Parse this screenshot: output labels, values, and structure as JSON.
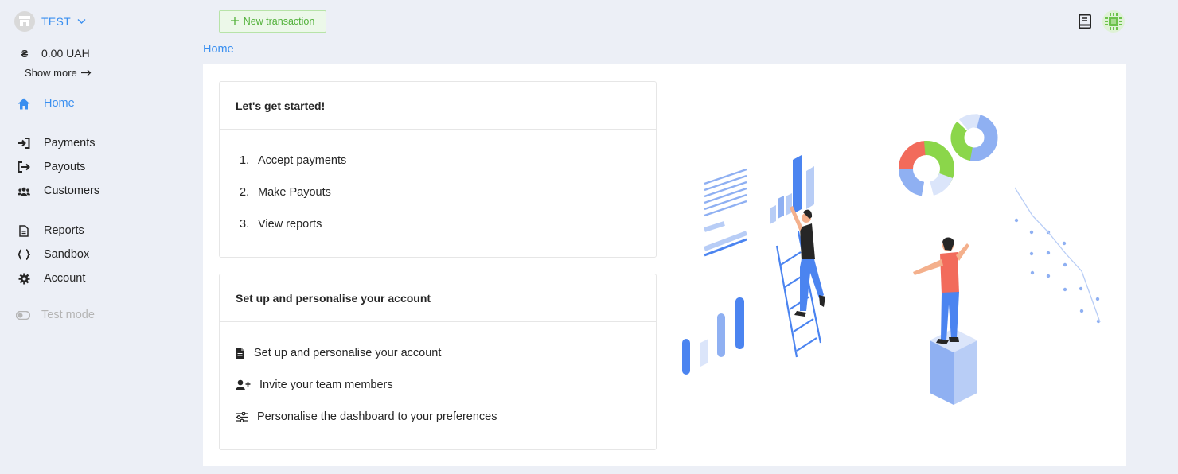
{
  "merchant": {
    "name": "TEST"
  },
  "balance": {
    "currency_symbol": "₴",
    "amount": "0.00 UAH",
    "show_more": "Show more"
  },
  "nav": {
    "home": "Home",
    "payments": "Payments",
    "payouts": "Payouts",
    "customers": "Customers",
    "reports": "Reports",
    "sandbox": "Sandbox",
    "account": "Account",
    "test_mode": "Test mode"
  },
  "toolbar": {
    "new_transaction": "New transaction"
  },
  "tabs": {
    "home": "Home"
  },
  "card_started": {
    "title": "Let's get started!",
    "items": [
      {
        "num": "1.",
        "label": "Accept payments"
      },
      {
        "num": "2.",
        "label": "Make Payouts"
      },
      {
        "num": "3.",
        "label": "View reports"
      }
    ]
  },
  "card_setup": {
    "title": "Set up and personalise your account",
    "items": [
      {
        "icon": "document-icon",
        "label": "Set up and personalise your account"
      },
      {
        "icon": "user-plus-icon",
        "label": "Invite your team members"
      },
      {
        "icon": "sliders-icon",
        "label": "Personalise the dashboard to your preferences"
      }
    ]
  },
  "colors": {
    "accent": "#3a8ff0",
    "success": "#52b13a",
    "background": "#eceff6"
  }
}
